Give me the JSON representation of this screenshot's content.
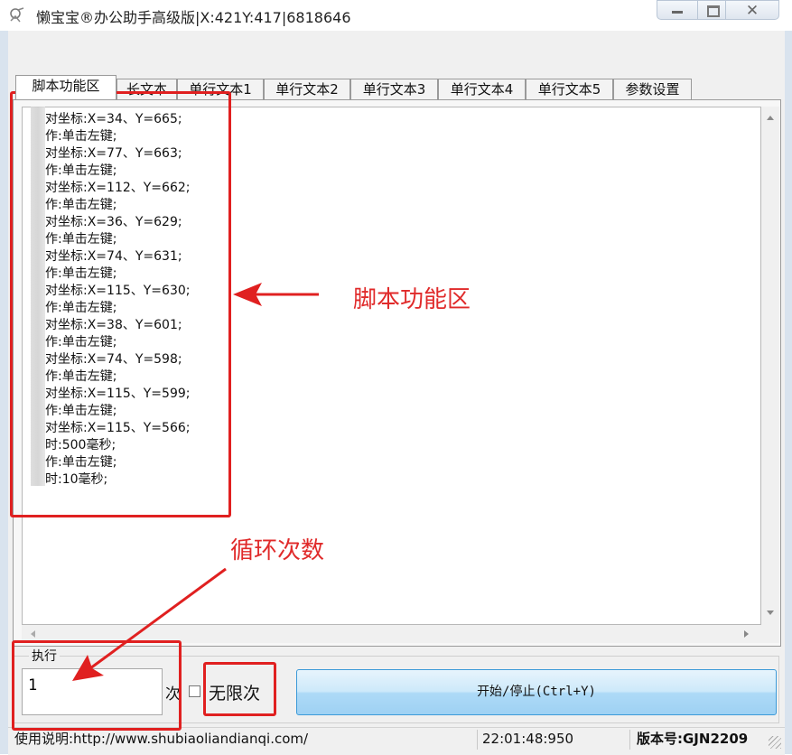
{
  "window": {
    "title": "懒宝宝®办公助手高级版|X:421Y:417|6818646",
    "controls": {
      "minimize": "minimize",
      "maximize": "maximize",
      "close": "✕"
    }
  },
  "tabs": [
    {
      "label": "脚本功能区",
      "active": true
    },
    {
      "label": "长文本"
    },
    {
      "label": "单行文本1"
    },
    {
      "label": "单行文本2"
    },
    {
      "label": "单行文本3"
    },
    {
      "label": "单行文本4"
    },
    {
      "label": "单行文本5"
    },
    {
      "label": "参数设置"
    }
  ],
  "script_lines": [
    "对坐标:X=34、Y=665;",
    "作:单击左键;",
    "对坐标:X=77、Y=663;",
    "作:单击左键;",
    "对坐标:X=112、Y=662;",
    "作:单击左键;",
    "对坐标:X=36、Y=629;",
    "作:单击左键;",
    "对坐标:X=74、Y=631;",
    "作:单击左键;",
    "对坐标:X=115、Y=630;",
    "作:单击左键;",
    "对坐标:X=38、Y=601;",
    "作:单击左键;",
    "对坐标:X=74、Y=598;",
    "作:单击左键;",
    "对坐标:X=115、Y=599;",
    "作:单击左键;",
    "对坐标:X=115、Y=566;",
    "时:500毫秒;",
    "作:单击左键;",
    "时:10毫秒;"
  ],
  "controls": {
    "exec_label": "执行",
    "count_value": "1",
    "times_label": "次",
    "unlimited_label": "无限次",
    "unlimited_checked": false,
    "start_button": "开始/停止(Ctrl+Y)"
  },
  "status": {
    "help": "使用说明:http://www.shubiaoliandianqi.com/",
    "time": "22:01:48:950",
    "version": "版本号:GJN2209"
  },
  "annotations": {
    "script_area": "脚本功能区",
    "loop_count": "循环次数",
    "color": "#e02020"
  }
}
